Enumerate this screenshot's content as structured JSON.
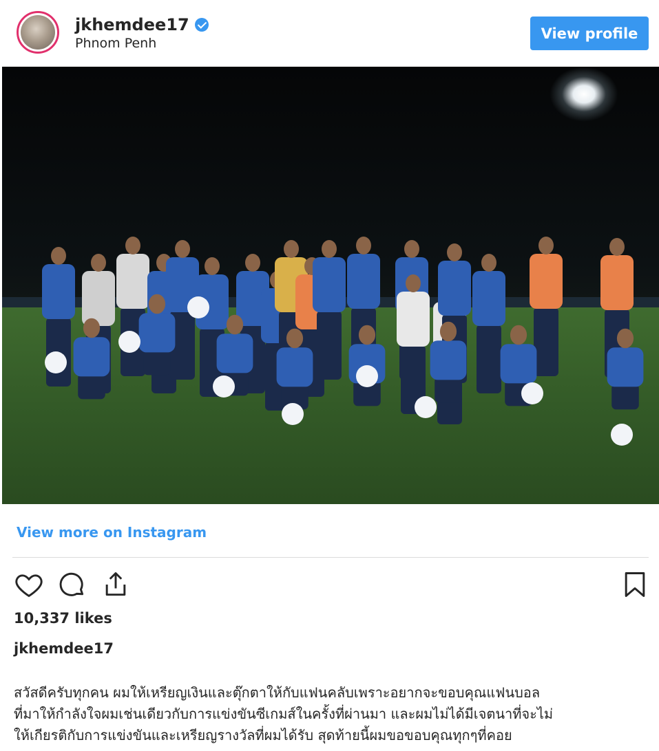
{
  "post": {
    "username": "jkhemdee17",
    "location": "Phnom Penh",
    "view_profile_label": "View profile",
    "view_more_label": "View more on Instagram",
    "likes": "10,337 likes",
    "caption_username": "jkhemdee17",
    "caption_line1": "สวัสดีครับทุกคน ผมให้เหรียญเงินและตุ๊กตาให้กับแฟนคลับเพราะอยากจะขอบคุณแฟนบอล",
    "caption_line2": "ที่มาให้กำลังใจผมเช่นเดียวกับการแข่งขันซีเกมส์ในครั้งที่ผ่านมา และผมไม่ได้มีเจตนาที่จะไม่",
    "caption_line3": "ให้เกียรติกับการแข่งขันและเหรียญรางวัลที่ผมได้รับ สุดท้ายนี้ผมขอขอบคุณทุกๆที่คอย"
  },
  "icons": {
    "verified": "verified-badge-icon",
    "like": "heart-icon",
    "comment": "comment-icon",
    "share": "share-icon",
    "save": "bookmark-icon"
  },
  "colors": {
    "accent": "#3897f0",
    "text": "#262626",
    "divider": "#dbdbdb",
    "jersey_blue": "#2f5fb3",
    "staff_orange": "#e8814a"
  }
}
